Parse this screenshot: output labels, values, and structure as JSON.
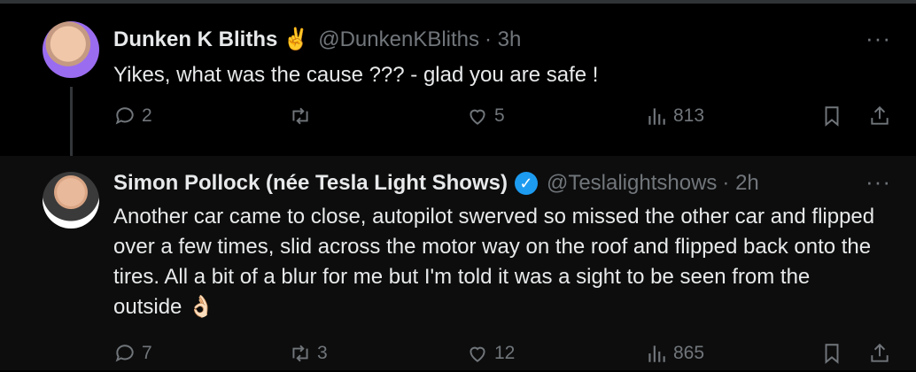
{
  "tweets": [
    {
      "name": "Dunken K Bliths",
      "name_emoji": "✌️",
      "handle": "@DunkenKBliths",
      "time": "· 3h",
      "text": "Yikes, what was the cause ??? - glad you are safe !",
      "replies": "2",
      "retweets": "",
      "likes": "5",
      "views": "813"
    },
    {
      "name": "Simon Pollock (née Tesla Light Shows)",
      "verified": true,
      "handle": "@Teslalightshows",
      "time": "· 2h",
      "text": "Another car came to close, autopilot swerved so missed the other car and flipped over a few times, slid across the motor way on the roof and flipped back onto the tires. All a bit of a blur for me but I'm told it was a sight to be seen from the outside 👌🏻",
      "replies": "7",
      "retweets": "3",
      "likes": "12",
      "views": "865"
    }
  ],
  "more_label": "···",
  "colors": {
    "background": "#000000",
    "text": "#e7e9ea",
    "muted": "#71767b",
    "verified": "#1d9bf0"
  },
  "icons": [
    "reply-icon",
    "retweet-icon",
    "like-icon",
    "views-icon",
    "bookmark-icon",
    "share-icon",
    "more-icon",
    "verified-badge-icon"
  ]
}
